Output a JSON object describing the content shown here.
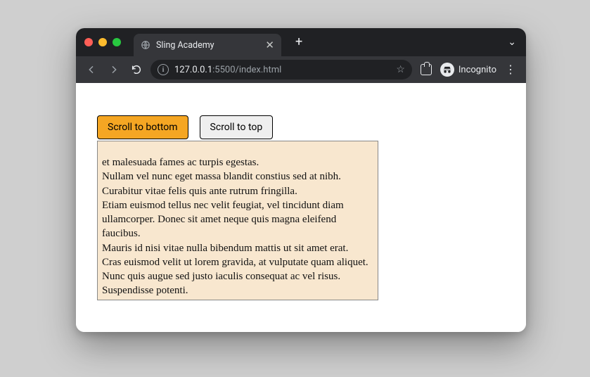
{
  "titlebar": {
    "tab_title": "Sling Academy",
    "close_glyph": "✕",
    "newtab_glyph": "+",
    "dropdown_glyph": "⌄"
  },
  "toolbar": {
    "url_host": "127.0.0.1",
    "url_path": ":5500/index.html",
    "star_glyph": "☆",
    "incognito_label": "Incognito",
    "kebab_glyph": "⋮"
  },
  "page": {
    "scroll_bottom_label": "Scroll to bottom",
    "scroll_top_label": "Scroll to top",
    "text_lines": [
      "et malesuada fames ac turpis egestas.",
      "Nullam vel nunc eget massa blandit constius sed at nibh.",
      "Curabitur vitae felis quis ante rutrum fringilla.",
      "Etiam euismod tellus nec velit feugiat, vel tincidunt diam ullamcorper. Donec sit amet neque quis magna eleifend faucibus.",
      "Mauris id nisi vitae nulla bibendum mattis ut sit amet erat.",
      "Cras euismod velit ut lorem gravida, at vulputate quam aliquet.",
      "Nunc quis augue sed justo iaculis consequat ac vel risus.",
      "Suspendisse potenti."
    ]
  }
}
